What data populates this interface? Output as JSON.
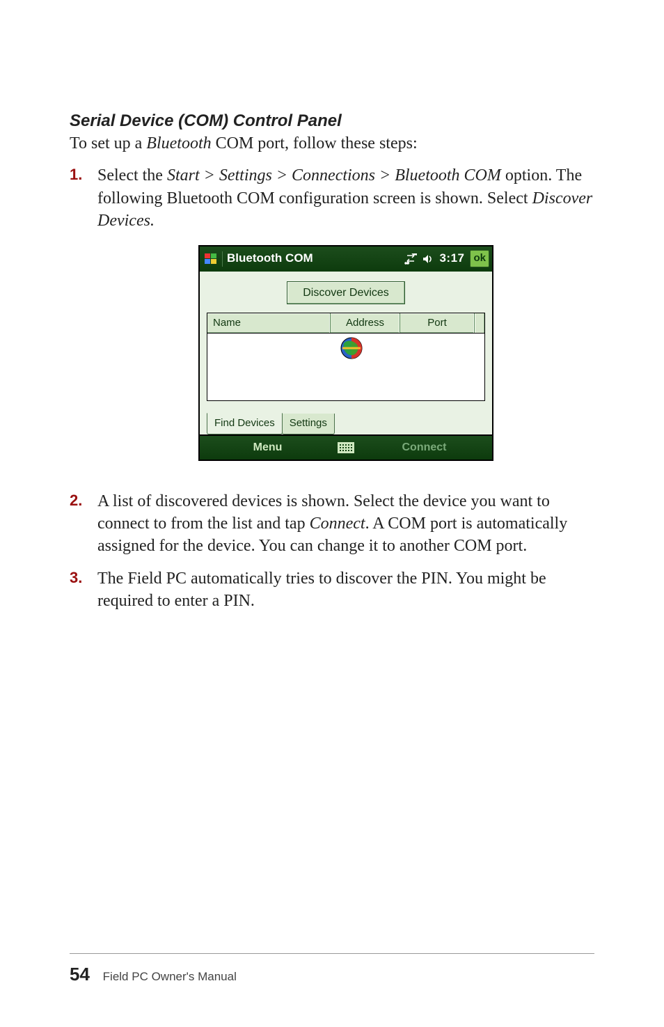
{
  "heading": "Serial Device (COM) Control Panel",
  "intro_pre": "To set up a ",
  "intro_ital": "Bluetooth",
  "intro_post": " COM port, follow these steps:",
  "steps": [
    {
      "num": "1.",
      "pre": "Select the ",
      "path": "Start > Settings > Connections > Bluetooth COM",
      "mid": " option. The following Bluetooth COM configuration screen is shown. Select ",
      "action": "Discover Devices.",
      "post": ""
    },
    {
      "num": "2.",
      "pre": "A list of discovered devices is shown. Select the device you want to connect to from the list and tap ",
      "action": "Connect",
      "post": ". A COM port is automatically assigned for the device. You can change it to another COM port."
    },
    {
      "num": "3.",
      "text": "The Field PC automatically tries to discover the PIN. You might be required to enter a PIN."
    }
  ],
  "screenshot": {
    "title": "Bluetooth COM",
    "time": "3:17",
    "ok": "ok",
    "discover_btn": "Discover Devices",
    "columns": {
      "name": "Name",
      "address": "Address",
      "port": "Port"
    },
    "tabs": {
      "find": "Find Devices",
      "settings": "Settings"
    },
    "softkeys": {
      "left": "Menu",
      "right": "Connect"
    }
  },
  "footer": {
    "page": "54",
    "title": "Field PC Owner's Manual"
  }
}
